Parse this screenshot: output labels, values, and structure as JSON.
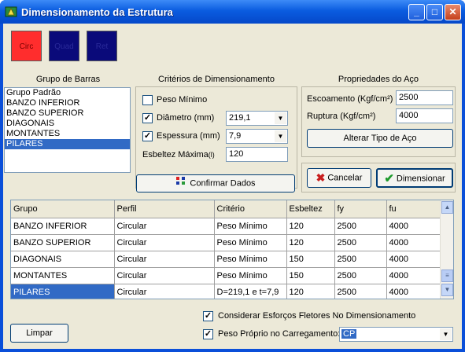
{
  "window": {
    "title": "Dimensionamento da Estrutura"
  },
  "color_buttons": [
    {
      "label": "Circ",
      "color": "#ff2d2d"
    },
    {
      "label": "Quad",
      "color": "#0a0a7a"
    },
    {
      "label": "Ret",
      "color": "#0a0a7a"
    }
  ],
  "grupo_barras": {
    "title": "Grupo de Barras",
    "items": [
      "Grupo Padrão",
      "BANZO INFERIOR",
      "BANZO SUPERIOR",
      "DIAGONAIS",
      "MONTANTES",
      "PILARES"
    ],
    "selected": "PILARES"
  },
  "criterios": {
    "title": "Critérios de Dimensionamento",
    "peso_minimo": {
      "label": "Peso Mínimo",
      "checked": false
    },
    "diametro": {
      "label": "Diâmetro (mm)",
      "checked": true,
      "value": "219,1"
    },
    "espessura": {
      "label": "Espessura (mm)",
      "checked": true,
      "value": "7,9"
    },
    "esbeltez": {
      "label": "Esbeltez Máxima",
      "suffix": "(l)",
      "value": "120"
    },
    "confirmar_label": "Confirmar Dados"
  },
  "propriedades": {
    "title": "Propriedades do Aço",
    "escoamento": {
      "label": "Escoamento (Kgf/cm²)",
      "value": "2500"
    },
    "ruptura": {
      "label": "Ruptura (Kgf/cm²)",
      "value": "4000"
    },
    "alterar_label": "Alterar Tipo de Aço"
  },
  "actions": {
    "cancelar": "Cancelar",
    "dimensionar": "Dimensionar"
  },
  "table": {
    "headers": [
      "Grupo",
      "Perfil",
      "Critério",
      "Esbeltez",
      "fy",
      "fu"
    ],
    "rows": [
      [
        "BANZO INFERIOR",
        "Circular",
        "Peso Mínimo",
        "120",
        "2500",
        "4000"
      ],
      [
        "BANZO SUPERIOR",
        "Circular",
        "Peso Mínimo",
        "120",
        "2500",
        "4000"
      ],
      [
        "DIAGONAIS",
        "Circular",
        "Peso Mínimo",
        "150",
        "2500",
        "4000"
      ],
      [
        "MONTANTES",
        "Circular",
        "Peso Mínimo",
        "150",
        "2500",
        "4000"
      ],
      [
        "PILARES",
        "Circular",
        "D=219,1 e  t=7,9",
        "120",
        "2500",
        "4000"
      ]
    ]
  },
  "bottom": {
    "limpar": "Limpar",
    "considerar": {
      "label": "Considerar Esforços Fletores No Dimensionamento",
      "checked": true
    },
    "peso_proprio": {
      "label": "Peso Próprio no Carregamento:",
      "checked": true,
      "value": "CP"
    }
  }
}
